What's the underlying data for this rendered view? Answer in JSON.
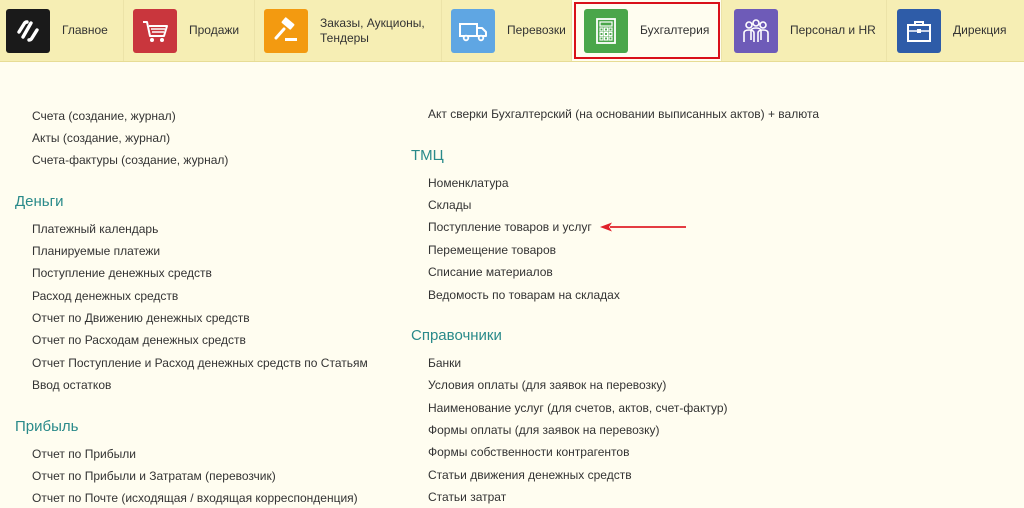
{
  "nav": {
    "items": [
      {
        "label": "Главное",
        "icon": "logo-icon",
        "color": "#1a1a1a"
      },
      {
        "label": "Продажи",
        "icon": "shopping-cart-icon",
        "color": "#c9363d"
      },
      {
        "label": "Заказы,  Аукционы, Тендеры",
        "icon": "gavel-icon",
        "color": "#f39a10"
      },
      {
        "label": "Перевозки",
        "icon": "truck-icon",
        "color": "#5fa6e3"
      },
      {
        "label": "Бухгалтерия",
        "icon": "calculator-icon",
        "color": "#4aa64a"
      },
      {
        "label": "Персонал и HR",
        "icon": "people-icon",
        "color": "#6e5bb8"
      },
      {
        "label": "Дирекция",
        "icon": "briefcase-icon",
        "color": "#2e5ca8"
      }
    ],
    "active_index": 4,
    "active_outline_color": "#d9101a"
  },
  "left": {
    "top_links": [
      "Счета (создание, журнал)",
      "Акты (создание, журнал)",
      "Счета-фактуры (создание, журнал)"
    ],
    "money": {
      "title": "Деньги",
      "links": [
        "Платежный календарь",
        "Планируемые платежи",
        "Поступление денежных средств",
        "Расход денежных средств",
        "Отчет по Движению денежных средств",
        "Отчет по Расходам денежных средств",
        "Отчет Поступление и Расход денежных средств по Статьям",
        "Ввод остатков"
      ]
    },
    "profit": {
      "title": "Прибыль",
      "links": [
        "Отчет по Прибыли",
        "Отчет по Прибыли и Затратам (перевозчик)",
        "Отчет по Почте (исходящая / входящая корреспонденция)"
      ]
    }
  },
  "right": {
    "top_links": [
      "Акт сверки Бухгалтерский (на основании выписанных актов) + валюта"
    ],
    "tmc": {
      "title": "ТМЦ",
      "links": [
        "Номенклатура",
        "Склады",
        "Поступление товаров и услуг",
        "Перемещение товаров",
        "Списание материалов",
        "Ведомость по товарам на складах"
      ]
    },
    "refs": {
      "title": "Справочники",
      "links": [
        "Банки",
        "Условия оплаты (для заявок на перевозку)",
        "Наименование услуг (для счетов, актов, счет-фактур)",
        "Формы оплаты (для заявок на перевозку)",
        "Формы собственности контрагентов",
        "Статьи движения денежных средств",
        "Статьи затрат"
      ]
    }
  },
  "annotation": {
    "arrow_color": "#e0202a"
  },
  "colors": {
    "section_title": "#2a8a8a",
    "link_text": "#333333",
    "topbar_bg": "#f6eeb4",
    "page_bg": "#fffdf0"
  }
}
